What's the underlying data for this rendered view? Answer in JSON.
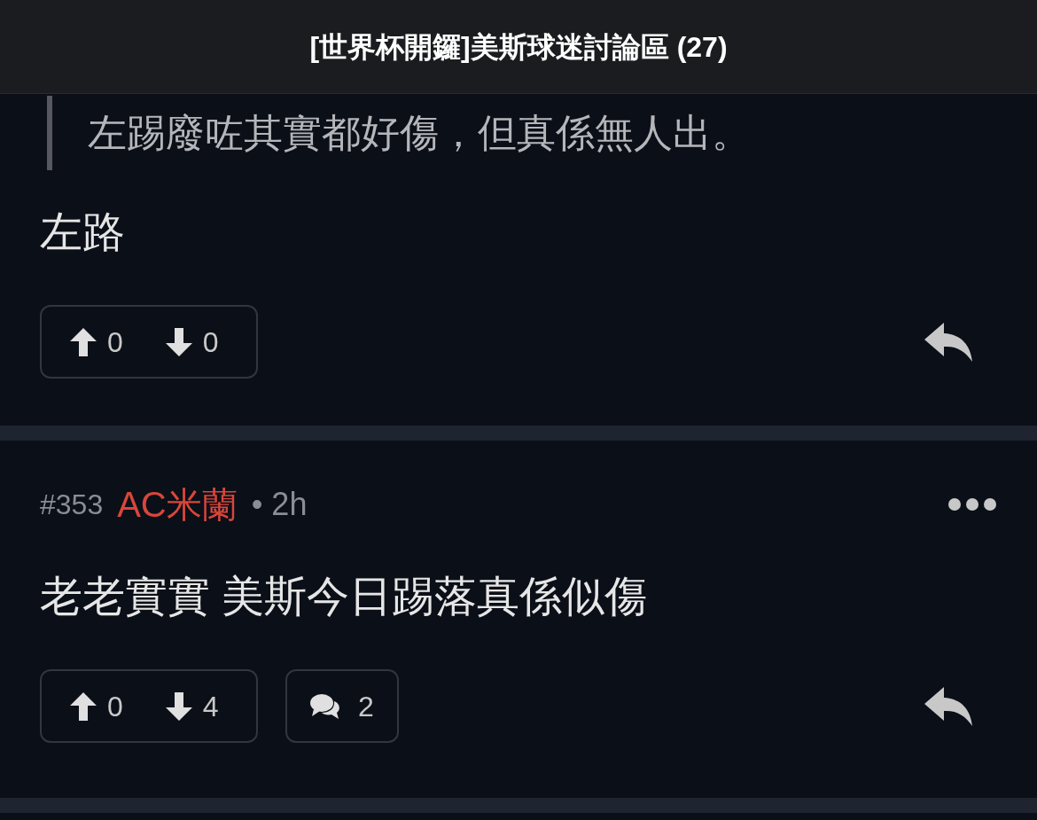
{
  "header": {
    "title": "[世界杯開鑼]美斯球迷討論區 (27)"
  },
  "posts": [
    {
      "quote": "左踢廢咗其實都好傷，但真係無人出。",
      "body": "左路",
      "upvotes": "0",
      "downvotes": "0"
    },
    {
      "number": "#353",
      "author": "AC米蘭",
      "time": "• 2h",
      "body": "老老實實 美斯今日踢落真係似傷",
      "upvotes": "0",
      "downvotes": "4",
      "replies": "2"
    }
  ]
}
